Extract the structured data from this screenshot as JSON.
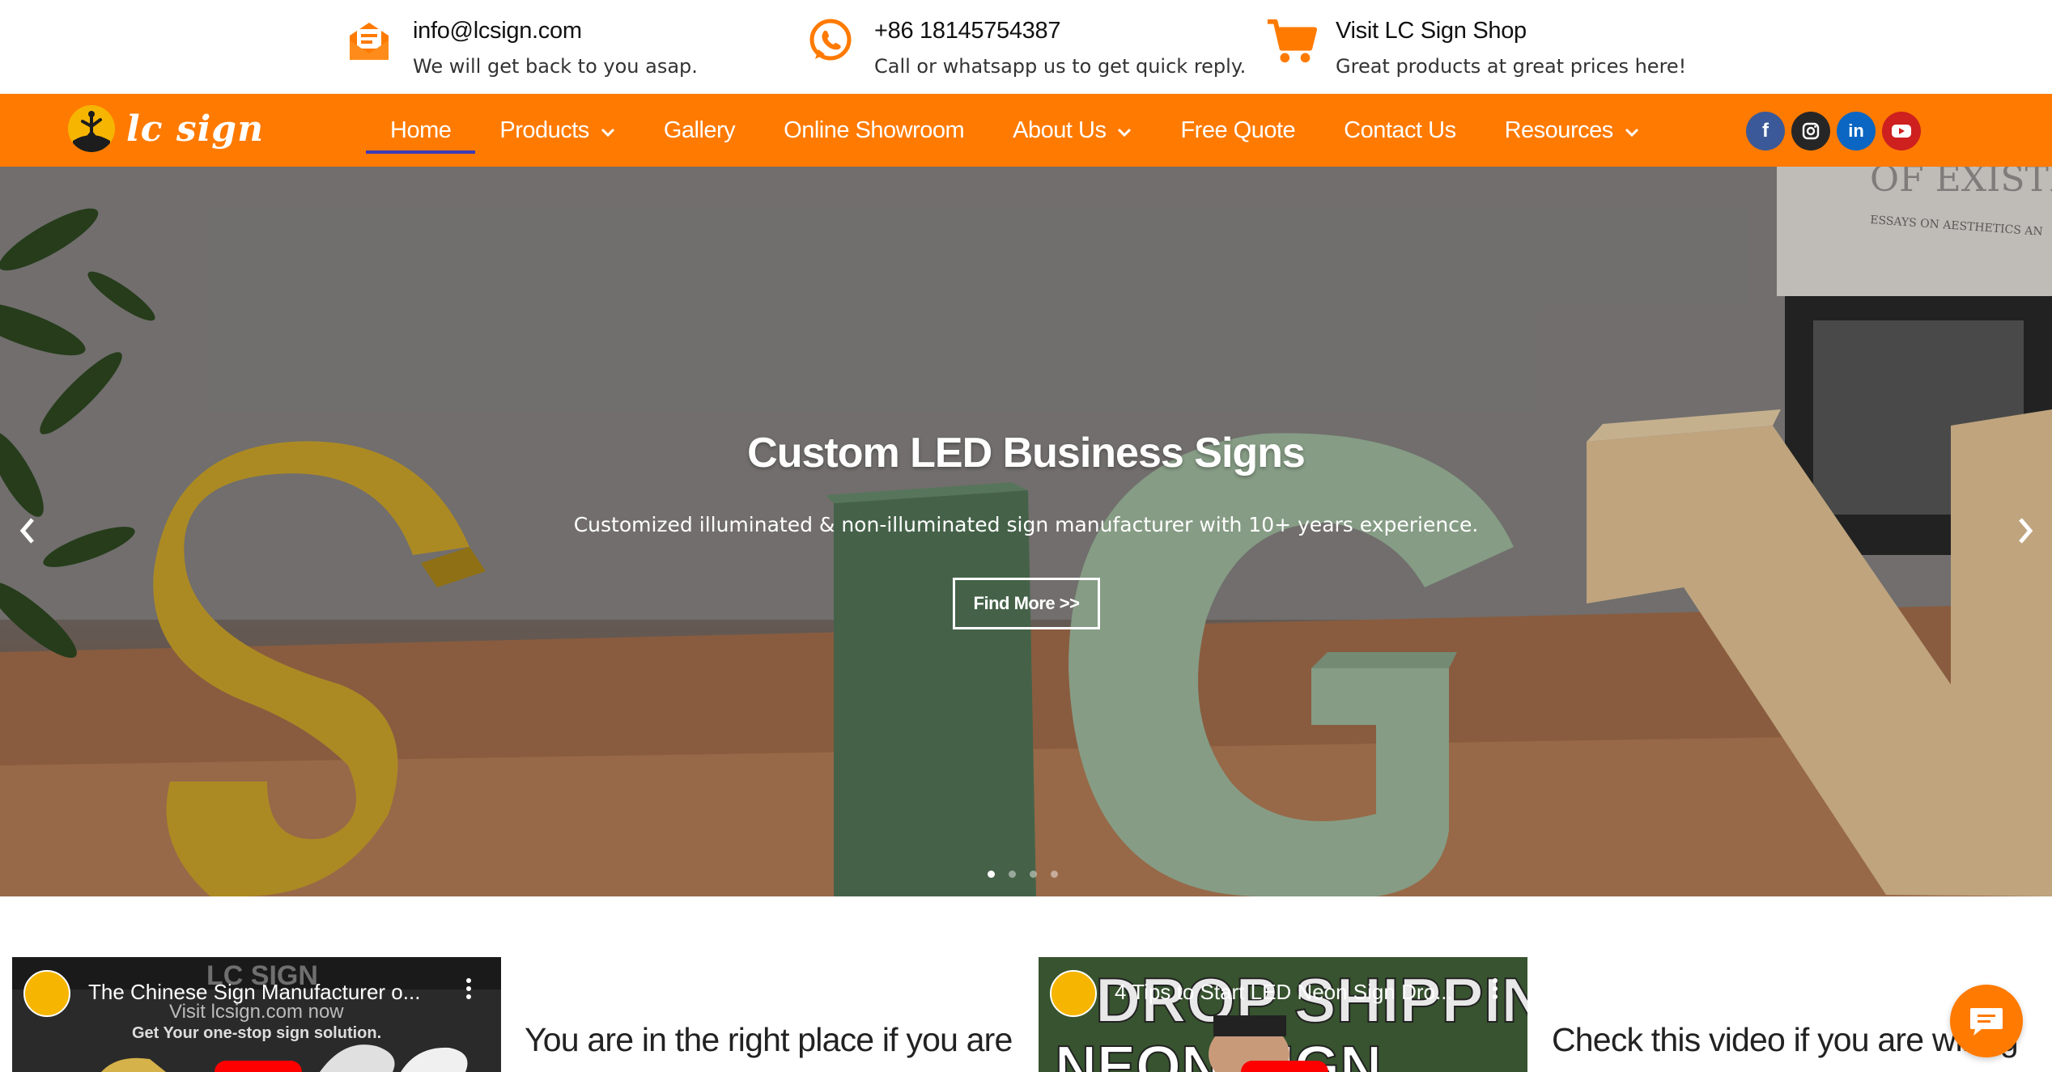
{
  "topbar": {
    "email": {
      "title": "info@lcsign.com",
      "subtitle": "We will get back to you asap.",
      "icon": "envelope-icon"
    },
    "phone": {
      "title": "+86 18145754387",
      "subtitle": "Call or whatsapp us to get quick reply.",
      "icon": "whatsapp-icon"
    },
    "shop": {
      "title": "Visit LC Sign Shop",
      "subtitle": "Great products at great prices here!",
      "icon": "shopping-cart-icon"
    }
  },
  "brand": {
    "logo_text": "lc sign",
    "accent": "#ff7a00"
  },
  "nav": {
    "items": [
      {
        "label": "Home",
        "active": true,
        "dropdown": false
      },
      {
        "label": "Products",
        "active": false,
        "dropdown": true
      },
      {
        "label": "Gallery",
        "active": false,
        "dropdown": false
      },
      {
        "label": "Online Showroom",
        "active": false,
        "dropdown": false
      },
      {
        "label": "About Us",
        "active": false,
        "dropdown": true
      },
      {
        "label": "Free Quote",
        "active": false,
        "dropdown": false
      },
      {
        "label": "Contact Us",
        "active": false,
        "dropdown": false
      },
      {
        "label": "Resources",
        "active": false,
        "dropdown": true
      }
    ],
    "socials": [
      {
        "icon": "facebook-icon",
        "glyph": "f",
        "color": "#3b5998"
      },
      {
        "icon": "instagram-icon",
        "glyph": "◎",
        "color": "#262626"
      },
      {
        "icon": "linkedin-icon",
        "glyph": "in",
        "color": "#0a66c2"
      },
      {
        "icon": "youtube-icon",
        "glyph": "▶",
        "color": "#cd201f"
      }
    ]
  },
  "hero": {
    "title": "Custom LED Business Signs",
    "subtitle": "Customized illuminated & non-illuminated sign manufacturer with 10+ years experience.",
    "button_label": "Find More >>",
    "book_text_1": "OF EXISTE",
    "book_text_2": "ESSAYS ON AESTHETICS AN",
    "slide_count": 4,
    "active_slide": 1
  },
  "videos": [
    {
      "title": "The Chinese Sign Manufacturer o...",
      "overlay_1": "LC SIGN",
      "overlay_2": "Visit lcsign.com now",
      "overlay_3": "Get Your one-stop sign solution.",
      "caption": "You are in the right place if you are"
    },
    {
      "title": "4 Tips to Start LED Neon Sign Dro...",
      "overlay_1": "DROP SHIPPING",
      "overlay_2": "NEON SIGN",
      "caption": "Check this video if you are willing"
    }
  ],
  "chat": {
    "icon": "chat-bubble-icon"
  }
}
